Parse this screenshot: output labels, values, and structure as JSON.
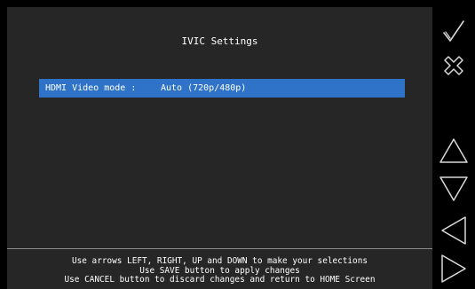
{
  "screen": {
    "title": "IVIC Settings",
    "settings": [
      {
        "label": "HDMI Video mode :",
        "value": "Auto (720p/480p)",
        "selected": true
      }
    ],
    "help_lines": [
      "Use arrows LEFT, RIGHT, UP and DOWN to make your selections",
      "Use SAVE button to apply changes",
      "Use CANCEL button to discard changes and return to HOME Screen"
    ]
  },
  "side_buttons": [
    {
      "name": "save",
      "icon": "checkmark-icon"
    },
    {
      "name": "cancel",
      "icon": "close-x-icon"
    },
    {
      "name": "up",
      "icon": "triangle-up-icon"
    },
    {
      "name": "down",
      "icon": "triangle-down-icon"
    },
    {
      "name": "left",
      "icon": "triangle-left-icon"
    },
    {
      "name": "right",
      "icon": "triangle-right-icon"
    }
  ],
  "colors": {
    "screen_bg": "#262626",
    "selection": "#2f73c8",
    "sidebar_bg": "#000000",
    "icon_stroke": "#d9d9d9"
  }
}
